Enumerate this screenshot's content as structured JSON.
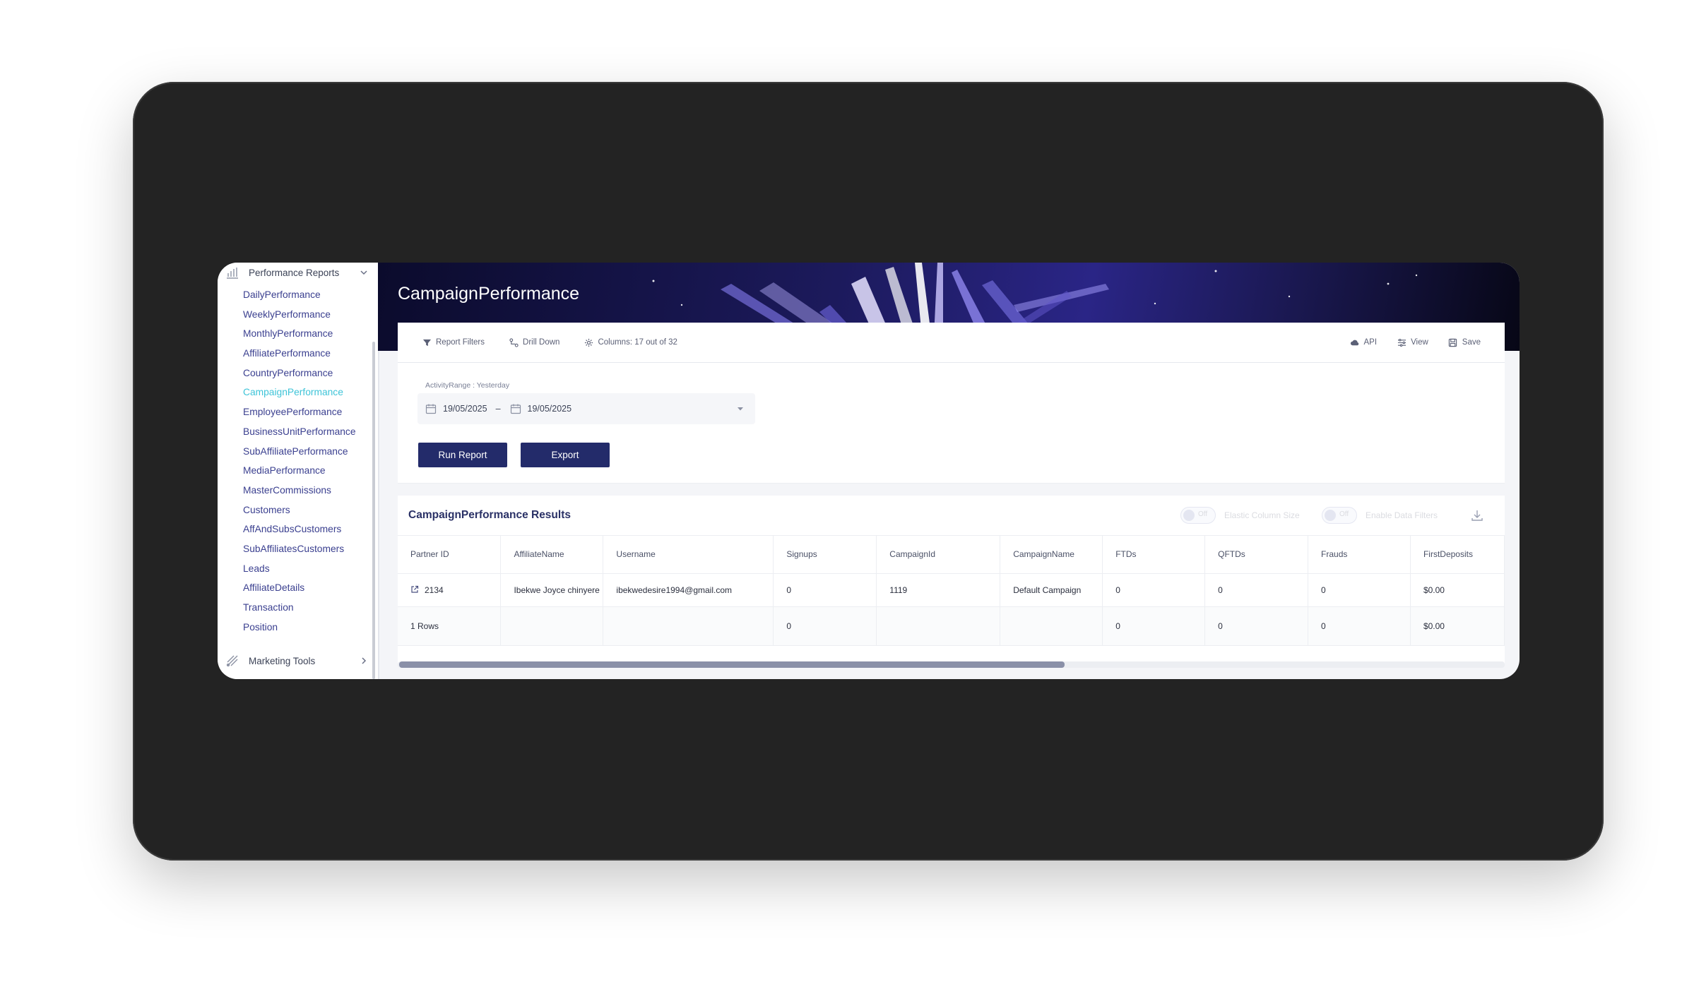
{
  "sidebar": {
    "group_performance": "Performance Reports",
    "items": [
      {
        "label": "DailyPerformance",
        "active": false
      },
      {
        "label": "WeeklyPerformance",
        "active": false
      },
      {
        "label": "MonthlyPerformance",
        "active": false
      },
      {
        "label": "AffiliatePerformance",
        "active": false
      },
      {
        "label": "CountryPerformance",
        "active": false
      },
      {
        "label": "CampaignPerformance",
        "active": true
      },
      {
        "label": "EmployeePerformance",
        "active": false
      },
      {
        "label": "BusinessUnitPerformance",
        "active": false
      },
      {
        "label": "SubAffiliatePerformance",
        "active": false
      },
      {
        "label": "MediaPerformance",
        "active": false
      },
      {
        "label": "MasterCommissions",
        "active": false
      },
      {
        "label": "Customers",
        "active": false
      },
      {
        "label": "AffAndSubsCustomers",
        "active": false
      },
      {
        "label": "SubAffiliatesCustomers",
        "active": false
      },
      {
        "label": "Leads",
        "active": false
      },
      {
        "label": "AffiliateDetails",
        "active": false
      },
      {
        "label": "Transaction",
        "active": false
      },
      {
        "label": "Position",
        "active": false
      }
    ],
    "group_marketing": "Marketing Tools"
  },
  "header": {
    "title": "CampaignPerformance"
  },
  "toolbar": {
    "report_filters": "Report Filters",
    "drill_down": "Drill Down",
    "columns": "Columns: 17 out of 32",
    "api": "API",
    "view": "View",
    "save": "Save"
  },
  "filters": {
    "range_label": "ActivityRange : Yesterday",
    "date_from": "19/05/2025",
    "date_sep": "–",
    "date_to": "19/05/2025",
    "run_label": "Run Report",
    "export_label": "Export"
  },
  "results": {
    "title": "CampaignPerformance Results",
    "toggle1_state": "Off",
    "toggle1_label": "Elastic Column Size",
    "toggle2_state": "Off",
    "toggle2_label": "Enable Data Filters",
    "columns": [
      "Partner ID",
      "AffiliateName",
      "Username",
      "Signups",
      "CampaignId",
      "CampaignName",
      "FTDs",
      "QFTDs",
      "Frauds",
      "FirstDeposits"
    ],
    "rows": [
      [
        "2134",
        "Ibekwe Joyce chinyere",
        "ibekwedesire1994@gmail.com",
        "0",
        "1119",
        "Default Campaign",
        "0",
        "0",
        "0",
        "$0.00"
      ]
    ],
    "totals": [
      "1 Rows",
      "",
      "",
      "0",
      "",
      "",
      "0",
      "0",
      "0",
      "$0.00"
    ]
  },
  "colors": {
    "accent": "#232b6a",
    "active_nav": "#3ec4d8",
    "nav_text": "#3a3f8f"
  }
}
